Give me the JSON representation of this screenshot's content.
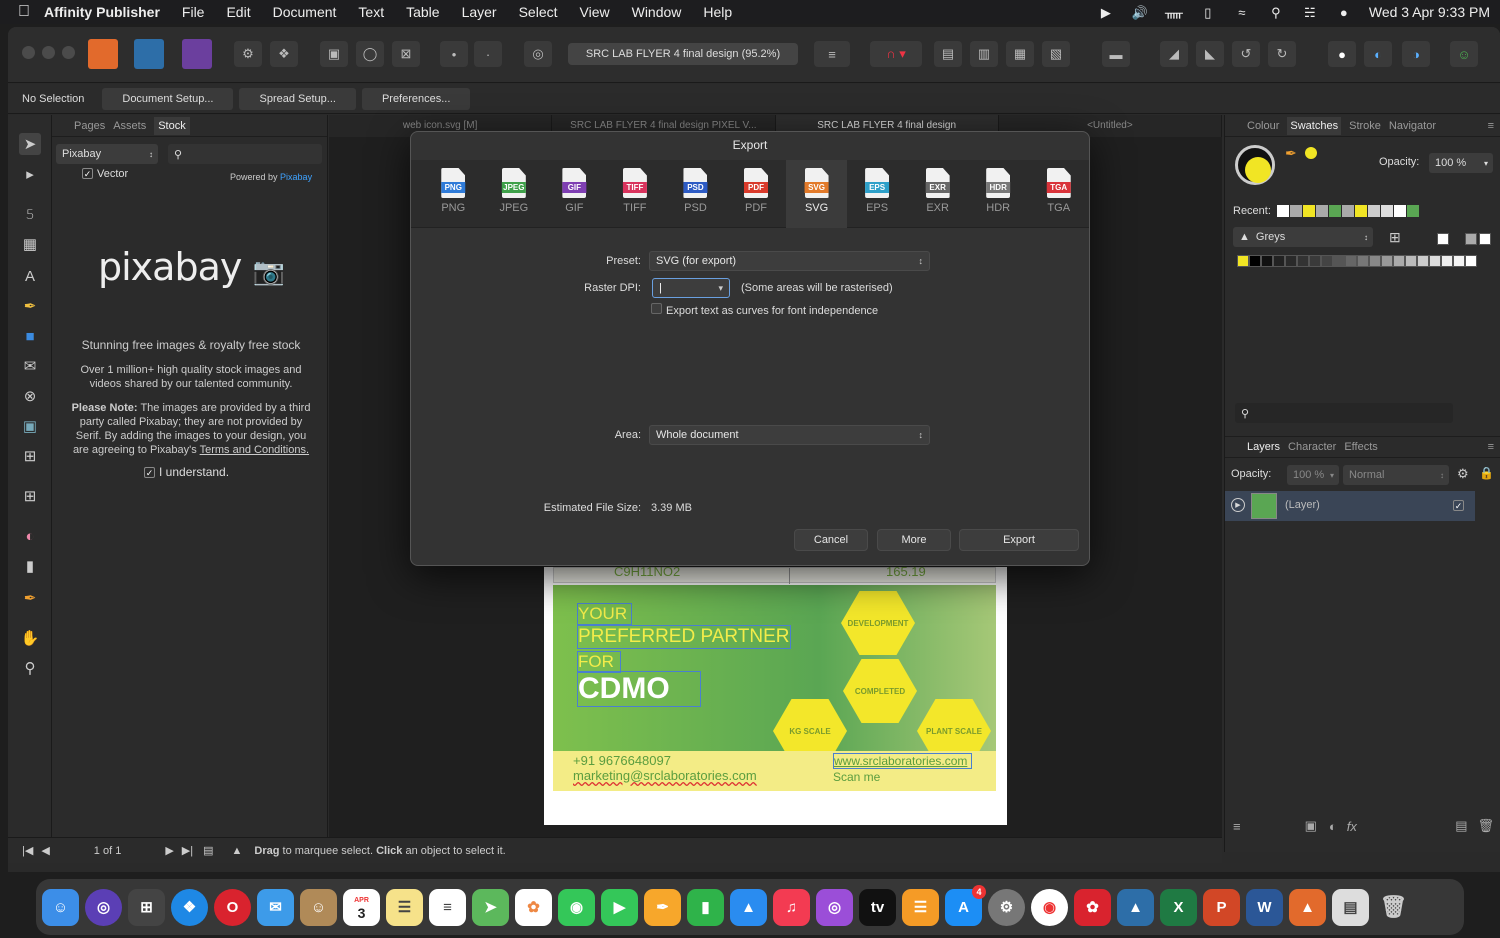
{
  "menubar": {
    "app_name": "Affinity Publisher",
    "items": [
      "File",
      "Edit",
      "Document",
      "Text",
      "Table",
      "Layer",
      "Select",
      "View",
      "Window",
      "Help"
    ],
    "clock": "Wed 3 Apr  9:33 PM"
  },
  "toolbar": {
    "doc_title": "SRC LAB FLYER 4 final design (95.2%)"
  },
  "contextbar": {
    "selection": "No Selection",
    "buttons": [
      "Document Setup...",
      "Spread Setup...",
      "Preferences..."
    ]
  },
  "stock_panel": {
    "tabs": [
      "Pages",
      "Assets",
      "Stock"
    ],
    "source": "Pixabay",
    "vector_label": "Vector",
    "powered_by": "Powered by",
    "powered_link": "Pixabay",
    "logo_text": "pixabay",
    "headline": "Stunning free images & royalty free stock",
    "subline": "Over 1 million+ high quality stock images and videos shared by our talented community.",
    "note_bold": "Please Note:",
    "note_text": "The images are provided by a third party called Pixabay; they are not provided by Serif. By adding the images to your design, you are agreeing to Pixabay's",
    "note_link": "Terms and Conditions.",
    "understand_label": "I understand."
  },
  "doc_tabs": [
    "web icon.svg [M]",
    "SRC LAB FLYER 4 final design PIXEL V...",
    "SRC LAB FLYER 4 final design",
    "<Untitled>"
  ],
  "flyer": {
    "formula": "C9H11NO2",
    "value": "165.19",
    "line1": "YOUR",
    "line2": "PREFERRED PARTNER",
    "line3": "FOR",
    "line4": "CDMO",
    "hex_labels": [
      "DEVELOPMENT",
      "COMPLETED",
      "KG SCALE",
      "PLANT SCALE"
    ],
    "phone": "+91 9676648097",
    "email": "marketing@srclaboratories.com",
    "website": "www.srclaboratories.com",
    "scan": "Scan me"
  },
  "statusbar": {
    "page_info": "1 of 1",
    "hint_bold1": "Drag",
    "hint1": " to marquee select. ",
    "hint_bold2": "Click",
    "hint2": " an object to select it."
  },
  "right_panel": {
    "top_tabs": [
      "Colour",
      "Swatches",
      "Stroke",
      "Navigator"
    ],
    "opacity_label": "Opacity:",
    "opacity_value": "100 %",
    "recent_label": "Recent:",
    "palette": "Greys",
    "layer_tabs": [
      "Layers",
      "Character",
      "Effects"
    ],
    "layer_opacity_label": "Opacity:",
    "layer_opacity_value": "100 %",
    "blend_mode": "Normal",
    "layer_name": "(Layer)"
  },
  "export_dialog": {
    "title": "Export",
    "formats": [
      {
        "name": "PNG",
        "color": "#2f7bd8"
      },
      {
        "name": "JPEG",
        "color": "#3fa14a"
      },
      {
        "name": "GIF",
        "color": "#7f3fb3"
      },
      {
        "name": "TIFF",
        "color": "#d9335d"
      },
      {
        "name": "PSD",
        "color": "#2d5bc4"
      },
      {
        "name": "PDF",
        "color": "#d93a2b"
      },
      {
        "name": "SVG",
        "color": "#e27a2a"
      },
      {
        "name": "EPS",
        "color": "#2ea0c9"
      },
      {
        "name": "EXR",
        "color": "#666666"
      },
      {
        "name": "HDR",
        "color": "#777777"
      },
      {
        "name": "TGA",
        "color": "#d9333a"
      }
    ],
    "active_format": "SVG",
    "preset_label": "Preset:",
    "preset_value": "SVG (for export)",
    "raster_dpi_label": "Raster DPI:",
    "raster_note": "(Some areas will be rasterised)",
    "curves_label": "Export text as curves for font independence",
    "area_label": "Area:",
    "area_value": "Whole document",
    "size_label": "Estimated File Size:",
    "size_value": "3.39 MB",
    "cancel": "Cancel",
    "more": "More",
    "export": "Export"
  },
  "dock": {
    "calendar_month": "APR",
    "calendar_day": "3",
    "badge": "4"
  }
}
